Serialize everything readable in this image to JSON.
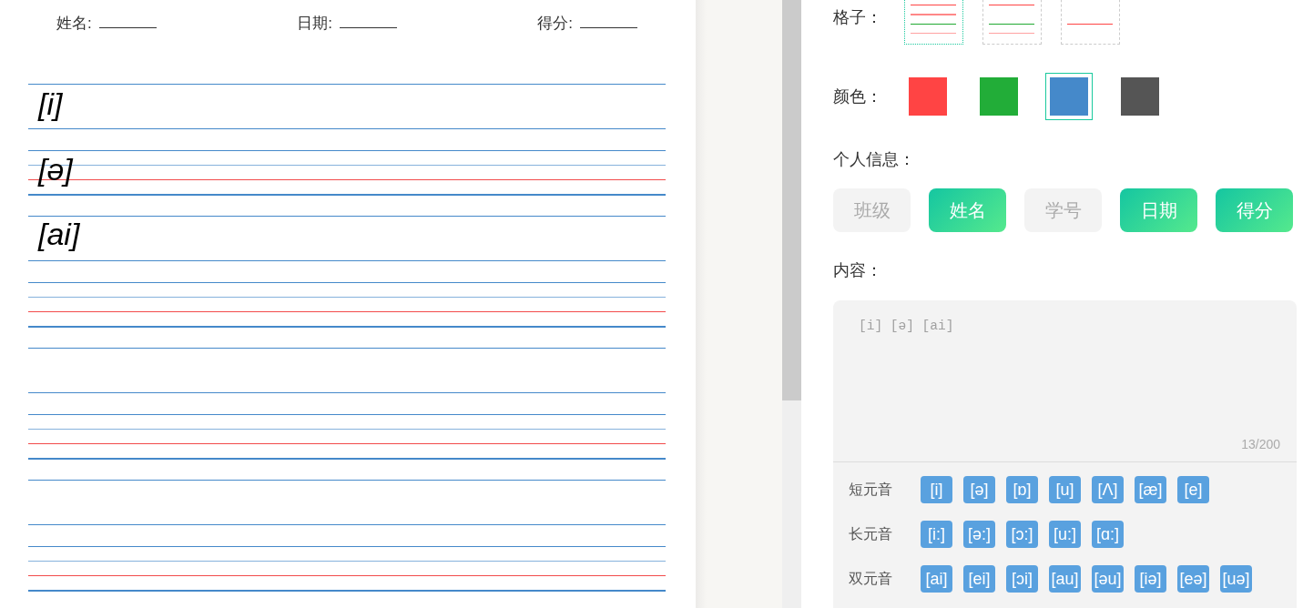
{
  "worksheet": {
    "header_fields": [
      {
        "label": "姓名:"
      },
      {
        "label": "日期:"
      },
      {
        "label": "得分:"
      }
    ],
    "entries": [
      "[i]",
      "[ə]",
      "[ai]"
    ]
  },
  "settings": {
    "grid": {
      "label": "格子：",
      "options": [
        {
          "kind": "four_line",
          "selected": true
        },
        {
          "kind": "three_line",
          "selected": false
        },
        {
          "kind": "one_line",
          "selected": false
        }
      ]
    },
    "color": {
      "label": "颜色：",
      "options": [
        {
          "color": "#ff4444",
          "selected": false
        },
        {
          "color": "#22ad38",
          "selected": false
        },
        {
          "color": "#4589ca",
          "selected": true
        },
        {
          "color": "#555555",
          "selected": false
        }
      ]
    },
    "personal_info": {
      "label": "个人信息：",
      "options": [
        {
          "label": "班级",
          "selected": false
        },
        {
          "label": "姓名",
          "selected": true
        },
        {
          "label": "学号",
          "selected": false
        },
        {
          "label": "日期",
          "selected": true
        },
        {
          "label": "得分",
          "selected": true
        }
      ]
    },
    "content": {
      "label": "内容：",
      "value": "[i] [ə] [ai]",
      "counter": "13/200"
    },
    "phonetic_keyboard": {
      "groups": [
        {
          "label": "短元音",
          "keys": [
            "[i]",
            "[ə]",
            "[ɒ]",
            "[u]",
            "[Λ]",
            "[æ]",
            "[e]"
          ]
        },
        {
          "label": "长元音",
          "keys": [
            "[i:]",
            "[ə:]",
            "[ɔ:]",
            "[u:]",
            "[ɑ:]"
          ]
        },
        {
          "label": "双元音",
          "keys": [
            "[ai]",
            "[ei]",
            "[ɔi]",
            "[au]",
            "[əu]",
            "[iə]",
            "[eə]",
            "[uə]"
          ]
        }
      ]
    }
  }
}
